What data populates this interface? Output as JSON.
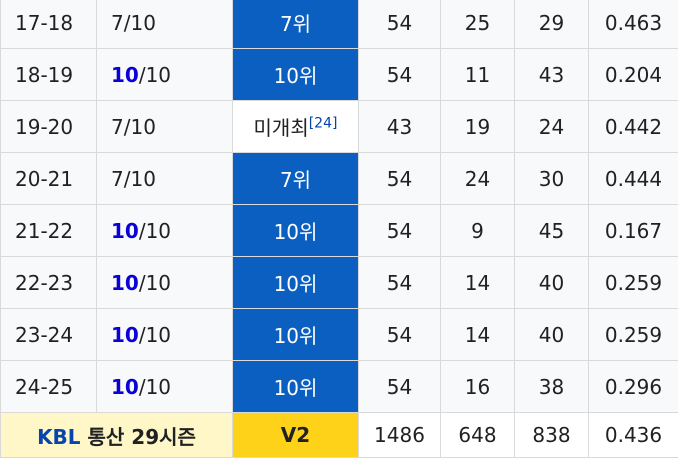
{
  "rows": [
    {
      "season": "17-18",
      "rank_prefix": "",
      "rank_plain": "7",
      "rank_total": "/10",
      "result": "7위",
      "note": "",
      "games": "54",
      "wins": "25",
      "losses": "29",
      "pct": "0.463",
      "colored": true
    },
    {
      "season": "18-19",
      "rank_prefix": "10",
      "rank_plain": "",
      "rank_total": "/10",
      "result": "10위",
      "note": "",
      "games": "54",
      "wins": "11",
      "losses": "43",
      "pct": "0.204",
      "colored": true
    },
    {
      "season": "19-20",
      "rank_prefix": "",
      "rank_plain": "7",
      "rank_total": "/10",
      "result": "미개최",
      "note": "[24]",
      "games": "43",
      "wins": "19",
      "losses": "24",
      "pct": "0.442",
      "colored": false
    },
    {
      "season": "20-21",
      "rank_prefix": "",
      "rank_plain": "7",
      "rank_total": "/10",
      "result": "7위",
      "note": "",
      "games": "54",
      "wins": "24",
      "losses": "30",
      "pct": "0.444",
      "colored": true
    },
    {
      "season": "21-22",
      "rank_prefix": "10",
      "rank_plain": "",
      "rank_total": "/10",
      "result": "10위",
      "note": "",
      "games": "54",
      "wins": "9",
      "losses": "45",
      "pct": "0.167",
      "colored": true
    },
    {
      "season": "22-23",
      "rank_prefix": "10",
      "rank_plain": "",
      "rank_total": "/10",
      "result": "10위",
      "note": "",
      "games": "54",
      "wins": "14",
      "losses": "40",
      "pct": "0.259",
      "colored": true
    },
    {
      "season": "23-24",
      "rank_prefix": "10",
      "rank_plain": "",
      "rank_total": "/10",
      "result": "10위",
      "note": "",
      "games": "54",
      "wins": "14",
      "losses": "40",
      "pct": "0.259",
      "colored": true
    },
    {
      "season": "24-25",
      "rank_prefix": "10",
      "rank_plain": "",
      "rank_total": "/10",
      "result": "10위",
      "note": "",
      "games": "54",
      "wins": "16",
      "losses": "38",
      "pct": "0.296",
      "colored": true
    }
  ],
  "total": {
    "league": "KBL",
    "label": " 통산 29시즌",
    "titles": "V2",
    "games": "1486",
    "wins": "648",
    "losses": "838",
    "pct": "0.436"
  },
  "colors": {
    "result_cell": "#0a5fc0",
    "top_rank_text": "#0b00d6",
    "total_label_bg": "#fff7c7",
    "titles_bg": "#ffd21a",
    "link": "#0645ad"
  }
}
